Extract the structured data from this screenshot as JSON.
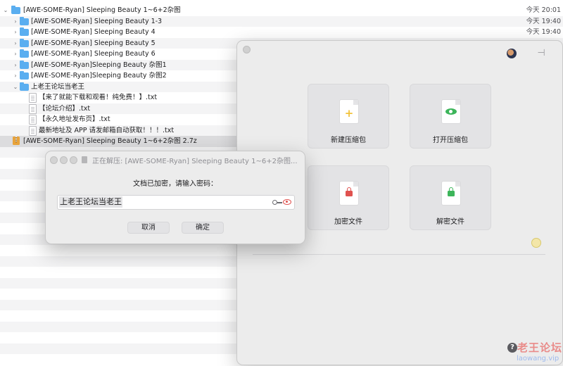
{
  "finder": {
    "rows": [
      {
        "name": "[AWE-SOME-Ryan] Sleeping Beauty 1~6+2杂图",
        "date": "今天 20:01",
        "kind": "folder",
        "chevron": "open"
      },
      {
        "name": "[AWE-SOME-Ryan] Sleeping Beauty 1-3",
        "date": "今天 19:40",
        "kind": "folder",
        "chevron": "closed"
      },
      {
        "name": "[AWE-SOME-Ryan] Sleeping Beauty 4",
        "date": "今天 19:40",
        "kind": "folder",
        "chevron": "closed"
      },
      {
        "name": "[AWE-SOME-Ryan] Sleeping Beauty 5",
        "date": "",
        "kind": "folder",
        "chevron": "closed"
      },
      {
        "name": "[AWE-SOME-Ryan] Sleeping Beauty 6",
        "date": "",
        "kind": "folder",
        "chevron": "closed"
      },
      {
        "name": "[AWE-SOME-Ryan]Sleeping Beauty 杂图1",
        "date": "",
        "kind": "folder",
        "chevron": "closed"
      },
      {
        "name": "[AWE-SOME-Ryan]Sleeping Beauty 杂图2",
        "date": "",
        "kind": "folder",
        "chevron": "closed"
      },
      {
        "name": "上老王论坛当老王",
        "date": "",
        "kind": "folder",
        "chevron": "open"
      },
      {
        "name": "【来了就能下载和观看！纯免费！】.txt",
        "date": "",
        "kind": "txt",
        "chevron": ""
      },
      {
        "name": "【论坛介绍】.txt",
        "date": "",
        "kind": "txt",
        "chevron": ""
      },
      {
        "name": "【永久地址发布页】.txt",
        "date": "",
        "kind": "txt",
        "chevron": ""
      },
      {
        "name": "最新地址及 APP 请发邮箱自动获取！！！.txt",
        "date": "",
        "kind": "txt",
        "chevron": ""
      },
      {
        "name": "[AWE-SOME-Ryan] Sleeping Beauty 1~6+2杂图 2.7z",
        "date": "",
        "kind": "archive",
        "chevron": ""
      }
    ]
  },
  "app": {
    "cards": [
      {
        "label": "新建压缩包",
        "icon": "plus-icon",
        "glyph": "+"
      },
      {
        "label": "打开压缩包",
        "icon": "eye-icon",
        "glyph": ""
      },
      {
        "label": "加密文件",
        "icon": "lock-red-icon",
        "glyph": ""
      },
      {
        "label": "解密文件",
        "icon": "lock-green-icon",
        "glyph": ""
      }
    ],
    "help_glyph": "?",
    "watermark_main": "老王论坛",
    "watermark_url": "laowang.vip"
  },
  "dialog": {
    "title": "正在解压: [AWE-SOME-Ryan] Sleeping Beauty 1~6+2杂图...",
    "prompt": "文档已加密，请输入密码：",
    "password": "上老王论坛当老王",
    "cancel_label": "取消",
    "ok_label": "确定"
  },
  "colors": {
    "folder_blue": "#5aaef0",
    "archive_orange": "#e8a33b",
    "accent_red": "#e0524f",
    "accent_green": "#3cb55a",
    "plus_yellow": "#f2c23a"
  }
}
